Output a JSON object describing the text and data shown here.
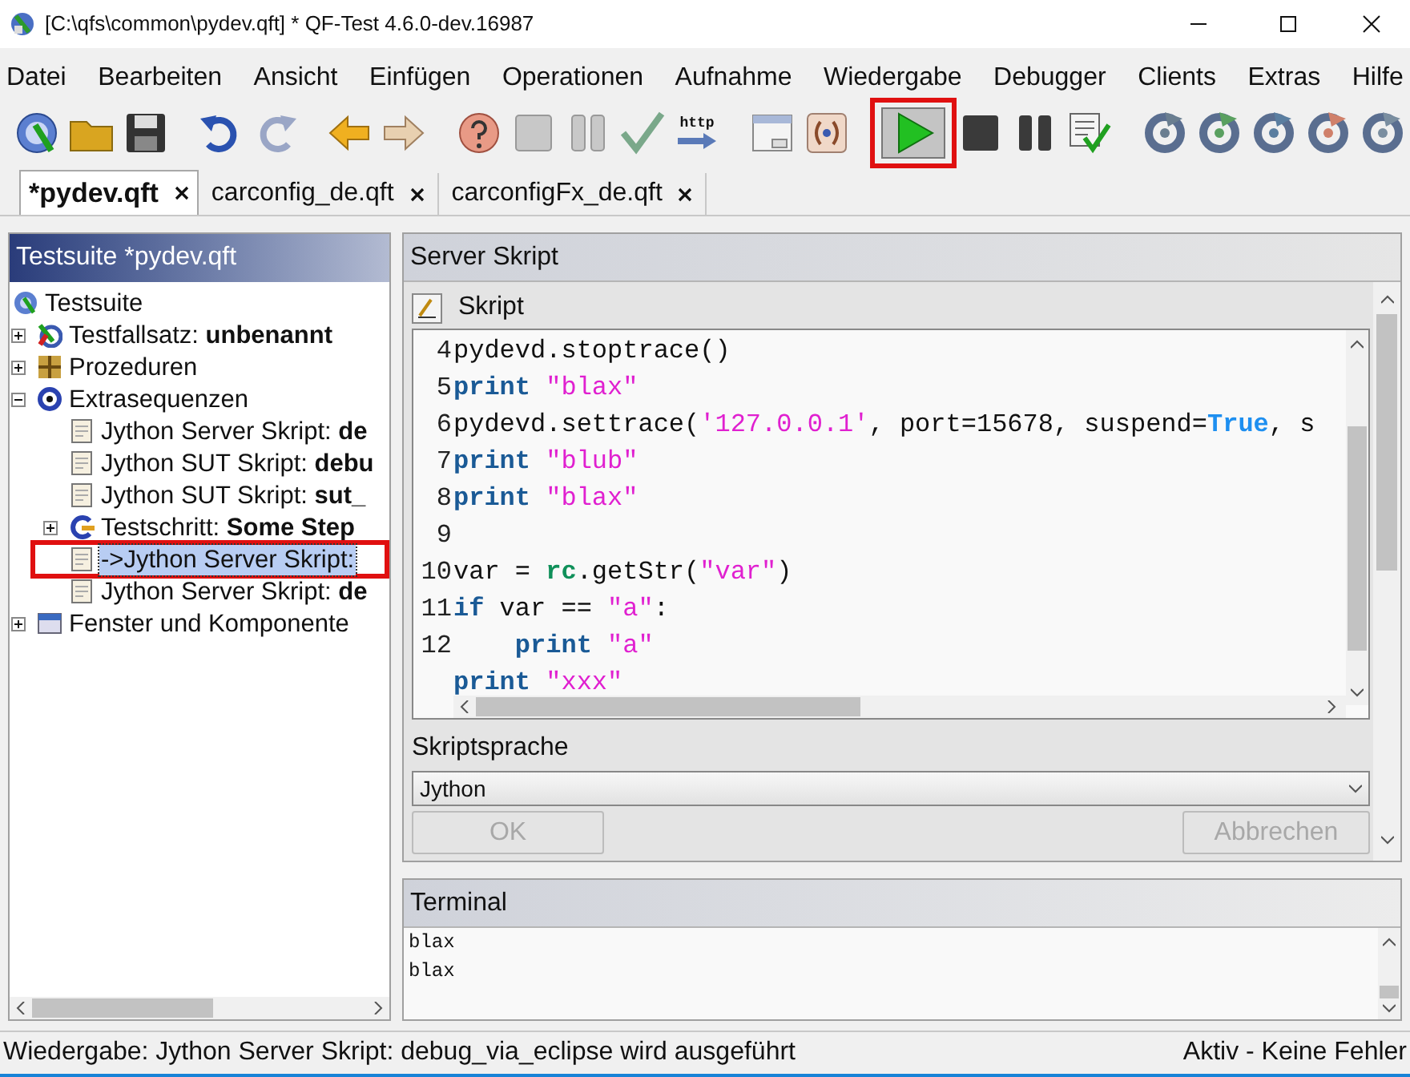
{
  "window": {
    "title": "[C:\\qfs\\common\\pydev.qft] * QF-Test 4.6.0-dev.16987"
  },
  "menu": [
    {
      "label": "Datei"
    },
    {
      "label": "Bearbeiten"
    },
    {
      "label": "Ansicht"
    },
    {
      "label": "Einfügen"
    },
    {
      "label": "Operationen"
    },
    {
      "label": "Aufnahme"
    },
    {
      "label": "Wiedergabe"
    },
    {
      "label": "Debugger"
    },
    {
      "label": "Clients"
    },
    {
      "label": "Extras"
    },
    {
      "label": "Hilfe"
    }
  ],
  "toolbar": [
    {
      "kind": "suite",
      "highlighted": false
    },
    {
      "kind": "open",
      "highlighted": false
    },
    {
      "kind": "save",
      "highlighted": false
    },
    {
      "kind": "gap"
    },
    {
      "kind": "undo",
      "highlighted": false
    },
    {
      "kind": "redo",
      "highlighted": false
    },
    {
      "kind": "gap"
    },
    {
      "kind": "back",
      "highlighted": false
    },
    {
      "kind": "forward",
      "highlighted": false
    },
    {
      "kind": "gap"
    },
    {
      "kind": "help",
      "highlighted": false
    },
    {
      "kind": "stop-off",
      "highlighted": false
    },
    {
      "kind": "pause-off",
      "highlighted": false
    },
    {
      "kind": "check",
      "highlighted": false
    },
    {
      "kind": "http",
      "label": "http",
      "highlighted": false
    },
    {
      "kind": "gap"
    },
    {
      "kind": "window",
      "highlighted": false
    },
    {
      "kind": "braces",
      "highlighted": false
    },
    {
      "kind": "gap"
    },
    {
      "kind": "play",
      "highlighted": true
    },
    {
      "kind": "stop",
      "highlighted": false
    },
    {
      "kind": "pause",
      "highlighted": false
    },
    {
      "kind": "checklist",
      "highlighted": false
    },
    {
      "kind": "gap"
    },
    {
      "kind": "step-in",
      "highlighted": false
    },
    {
      "kind": "step-over",
      "highlighted": false
    },
    {
      "kind": "step-out",
      "highlighted": false
    },
    {
      "kind": "skip-over",
      "highlighted": false
    },
    {
      "kind": "skip-out",
      "highlighted": false
    }
  ],
  "tabs": [
    {
      "label": "*pydev.qft",
      "selected": true
    },
    {
      "label": "carconfig_de.qft",
      "selected": false
    },
    {
      "label": "carconfigFx_de.qft",
      "selected": false
    }
  ],
  "tree": {
    "title": "Testsuite *pydev.qft",
    "items": [
      {
        "label": "Testsuite",
        "kind": "suite",
        "selected": false,
        "highlighted": false,
        "children": [
          {
            "label": "Testfallsatz: **unbenannt**",
            "kind": "testset",
            "expanded": false,
            "selected": false,
            "highlighted": false
          },
          {
            "label": "Prozeduren",
            "kind": "procedures",
            "expanded": false,
            "selected": false,
            "highlighted": false
          },
          {
            "label": "Extrasequenzen",
            "kind": "extras",
            "expanded": true,
            "selected": false,
            "highlighted": false,
            "children": [
              {
                "label": "Jython Server Skript: **de**",
                "kind": "script",
                "selected": false,
                "highlighted": false
              },
              {
                "label": "Jython SUT Skript: **debu**",
                "kind": "script",
                "selected": false,
                "highlighted": false
              },
              {
                "label": "Jython SUT Skript: **sut_**",
                "kind": "script",
                "selected": false,
                "highlighted": false
              },
              {
                "label": "Testschritt: **Some Step**",
                "kind": "step",
                "expanded": false,
                "selected": false,
                "highlighted": false
              },
              {
                "label": "->Jython Server Skript:",
                "kind": "script",
                "selected": true,
                "highlighted": true
              },
              {
                "label": "Jython Server Skript: **de**",
                "kind": "script",
                "selected": false,
                "highlighted": false
              }
            ]
          },
          {
            "label": "Fenster und Komponente",
            "kind": "windows",
            "expanded": false,
            "selected": false,
            "highlighted": false
          }
        ]
      }
    ]
  },
  "editor": {
    "title": "Server Skript",
    "script_label": "Skript",
    "lines": [
      {
        "number": "4",
        "tokens": [
          {
            "kind": "plain",
            "text": "pydevd.stoptrace()"
          }
        ]
      },
      {
        "number": "5",
        "tokens": [
          {
            "kind": "keyword",
            "text": "print"
          },
          {
            "kind": "string",
            "text": " \"blax\""
          }
        ]
      },
      {
        "number": "6",
        "tokens": [
          {
            "kind": "plain",
            "text": "pydevd.settrace("
          },
          {
            "kind": "string",
            "text": "'127.0.0.1'"
          },
          {
            "kind": "plain",
            "text": ", port=15678, suspend="
          },
          {
            "kind": "constant",
            "text": "True"
          },
          {
            "kind": "plain",
            "text": ", s"
          }
        ]
      },
      {
        "number": "7",
        "tokens": [
          {
            "kind": "keyword",
            "text": "print"
          },
          {
            "kind": "string",
            "text": " \"blub\""
          }
        ]
      },
      {
        "number": "8",
        "tokens": [
          {
            "kind": "keyword",
            "text": "print"
          },
          {
            "kind": "string",
            "text": " \"blax\""
          }
        ]
      },
      {
        "number": "9"
      },
      {
        "number": "10",
        "tokens": [
          {
            "kind": "plain",
            "text": "var = "
          },
          {
            "kind": "object",
            "text": "rc"
          },
          {
            "kind": "plain",
            "text": ".getStr("
          },
          {
            "kind": "string",
            "text": "\"var\""
          },
          {
            "kind": "plain",
            "text": ")"
          }
        ]
      },
      {
        "number": "11",
        "tokens": [
          {
            "kind": "keyword",
            "text": "if"
          },
          {
            "kind": "plain",
            "text": " var == "
          },
          {
            "kind": "string",
            "text": "\"a\""
          },
          {
            "kind": "plain",
            "text": ":"
          }
        ]
      },
      {
        "number": "12",
        "indented": true,
        "tokens": [
          {
            "kind": "keyword",
            "text": "print"
          },
          {
            "kind": "string",
            "text": " \"a\""
          }
        ]
      },
      {
        "tokens": [
          {
            "kind": "keyword",
            "text": "print"
          },
          {
            "kind": "string",
            "text": " \"xxx\""
          }
        ]
      }
    ],
    "language_label": "Skriptsprache",
    "language": "Jython",
    "buttons": [
      {
        "label": "OK",
        "disabled": true
      },
      {
        "label": "Abbrechen",
        "disabled": true
      }
    ]
  },
  "terminal": {
    "title": "Terminal",
    "lines": [
      "blax",
      "blax"
    ]
  },
  "status_bar": {
    "message": "Wiedergabe: Jython Server Skript: debug_via_eclipse wird ausgeführt",
    "state": "Aktiv - Keine Fehler"
  }
}
